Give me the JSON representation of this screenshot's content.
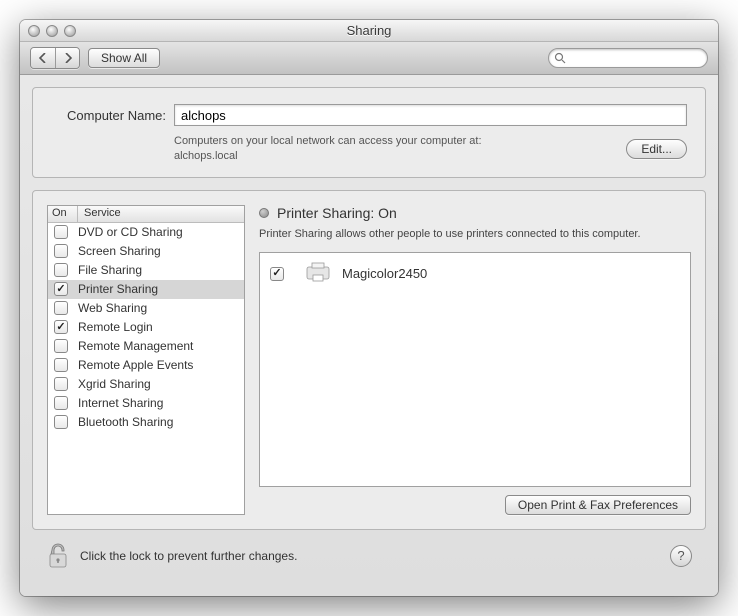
{
  "window_title": "Sharing",
  "toolbar": {
    "show_all": "Show All",
    "search_placeholder": ""
  },
  "computer_name": {
    "label": "Computer Name:",
    "value": "alchops",
    "hint_line1": "Computers on your local network can access your computer at:",
    "hint_line2": "alchops.local",
    "edit_button": "Edit..."
  },
  "services": {
    "header_on": "On",
    "header_service": "Service",
    "items": [
      {
        "label": "DVD or CD Sharing",
        "checked": false,
        "selected": false
      },
      {
        "label": "Screen Sharing",
        "checked": false,
        "selected": false
      },
      {
        "label": "File Sharing",
        "checked": false,
        "selected": false
      },
      {
        "label": "Printer Sharing",
        "checked": true,
        "selected": true
      },
      {
        "label": "Web Sharing",
        "checked": false,
        "selected": false
      },
      {
        "label": "Remote Login",
        "checked": true,
        "selected": false
      },
      {
        "label": "Remote Management",
        "checked": false,
        "selected": false
      },
      {
        "label": "Remote Apple Events",
        "checked": false,
        "selected": false
      },
      {
        "label": "Xgrid Sharing",
        "checked": false,
        "selected": false
      },
      {
        "label": "Internet Sharing",
        "checked": false,
        "selected": false
      },
      {
        "label": "Bluetooth Sharing",
        "checked": false,
        "selected": false
      }
    ]
  },
  "detail": {
    "title": "Printer Sharing: On",
    "description": "Printer Sharing allows other people to use printers connected to this computer.",
    "printers": [
      {
        "name": "Magicolor2450",
        "checked": true
      }
    ],
    "open_prefs": "Open Print & Fax Preferences"
  },
  "footer": {
    "lock_text": "Click the lock to prevent further changes."
  }
}
